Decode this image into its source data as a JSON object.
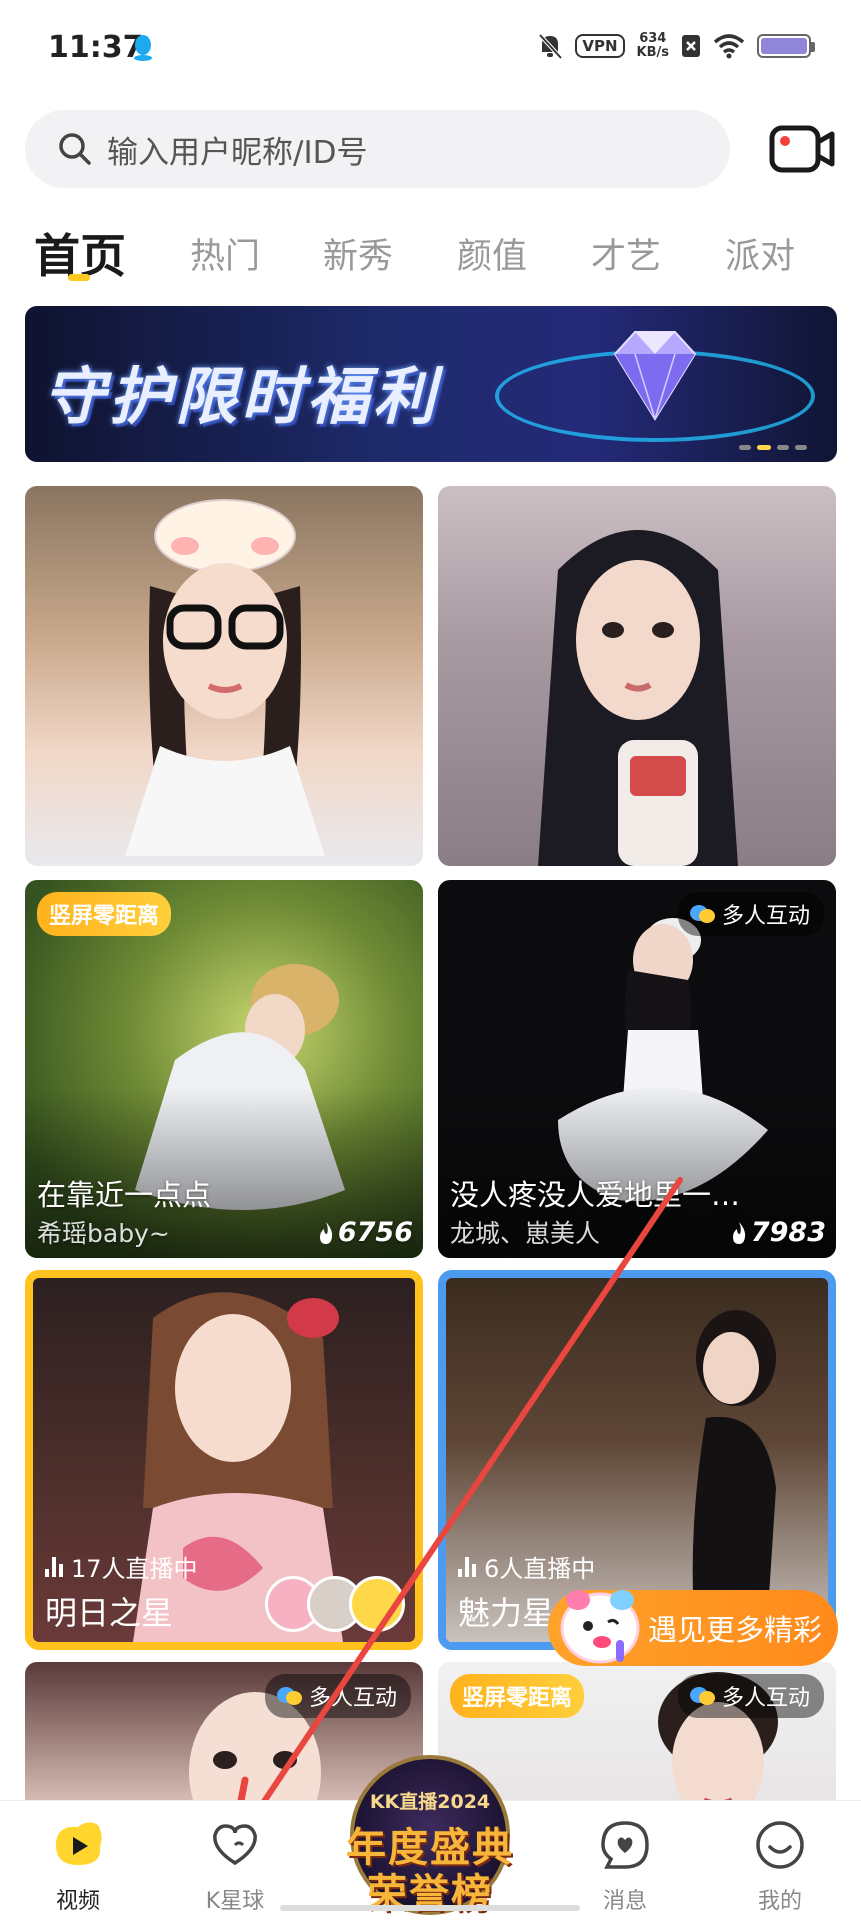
{
  "status_bar": {
    "time": "11:37",
    "vpn": "VPN",
    "speed_value": "634",
    "speed_unit": "KB/s"
  },
  "search": {
    "placeholder": "输入用户昵称/ID号"
  },
  "tabs": [
    "首页",
    "热门",
    "新秀",
    "颜值",
    "才艺",
    "派对"
  ],
  "active_tab": "首页",
  "banner": {
    "title": "守护限时福利"
  },
  "cards": [
    {
      "id": "card1"
    },
    {
      "id": "card2"
    },
    {
      "tag": "竖屏零距离",
      "title": "在靠近一点点",
      "subtitle": "希瑶baby~",
      "heat": "6756"
    },
    {
      "tag": "多人互动",
      "title": "没人疼没人爱地里一…",
      "subtitle": "龙城、崽美人",
      "heat": "7983"
    },
    {
      "live": "17人直播中",
      "name": "明日之星"
    },
    {
      "live": "6人直播中",
      "name": "魅力星"
    },
    {
      "tag": "多人互动"
    },
    {
      "tag_left": "竖屏零距离",
      "tag_right": "多人互动"
    }
  ],
  "floating_button": {
    "label": "遇见更多精彩"
  },
  "bottom_nav": {
    "items": [
      "视频",
      "K星球",
      "消息",
      "我的"
    ],
    "center_badge": {
      "line1": "KK直播2024",
      "line2": "年度盛典",
      "line3": "荣誉榜"
    }
  },
  "colors": {
    "accent_yellow": "#ffc21e",
    "accent_blue": "#4d9bf0",
    "float_orange": "#ff8a1c",
    "arrow_red": "#e8463e"
  }
}
